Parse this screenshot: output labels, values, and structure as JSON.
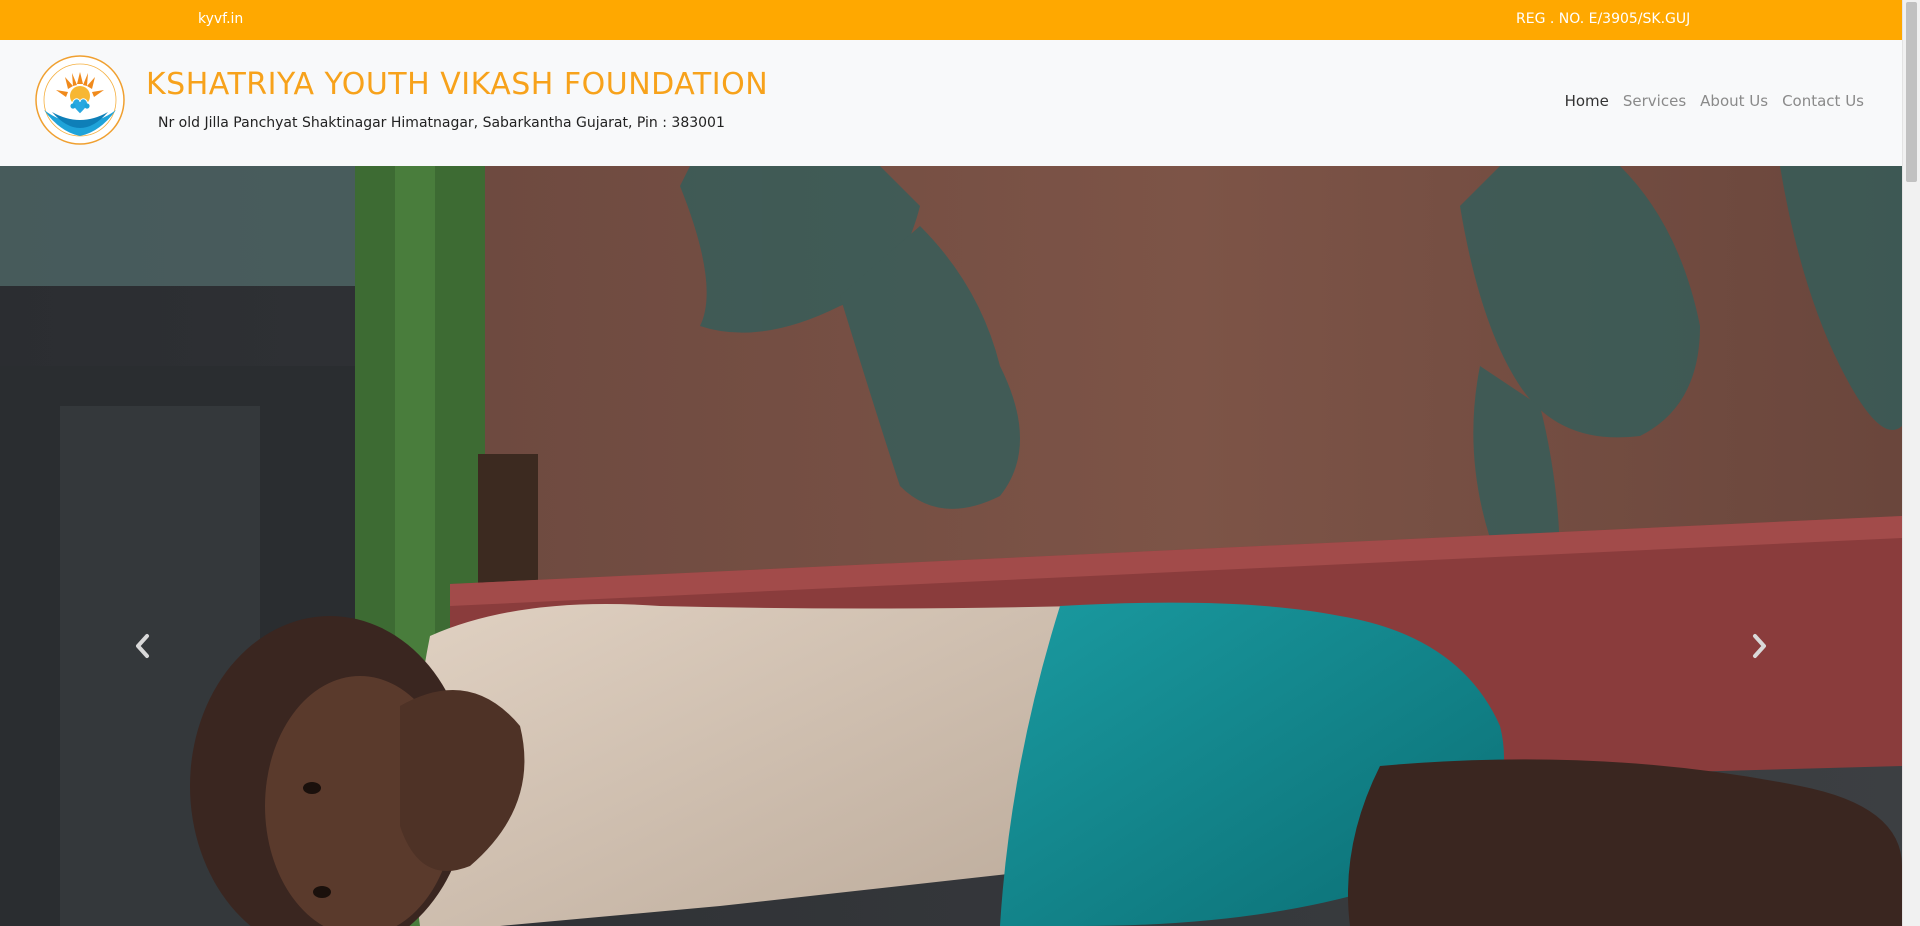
{
  "topbar": {
    "domain": "kyvf.in",
    "registration": "REG . NO. E/3905/SK.GUJ"
  },
  "header": {
    "title": "KSHATRIYA YOUTH VIKASH FOUNDATION",
    "address": "Nr old Jilla Panchyat Shaktinagar Himatnagar, Sabarkantha Gujarat, Pin : 383001"
  },
  "nav": {
    "items": [
      {
        "label": "Home",
        "active": true
      },
      {
        "label": "Services",
        "active": false
      },
      {
        "label": "About Us",
        "active": false
      },
      {
        "label": "Contact Us",
        "active": false
      }
    ]
  },
  "carousel": {
    "prev_icon": "chevron-left-icon",
    "next_icon": "chevron-right-icon"
  },
  "colors": {
    "topbar": "#ffa800",
    "brand_title": "#f7a21b",
    "header_bg": "#f8f9fa"
  }
}
